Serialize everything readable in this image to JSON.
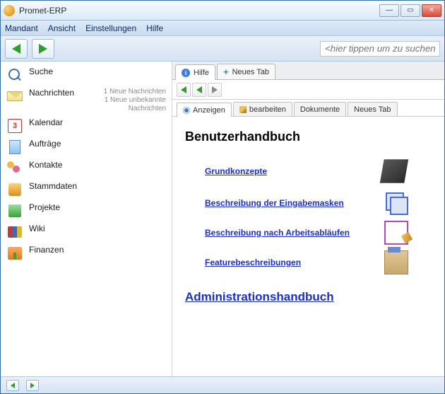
{
  "window": {
    "title": "Promet-ERP"
  },
  "menu": {
    "items": [
      "Mandant",
      "Ansicht",
      "Einstellungen",
      "Hilfe"
    ]
  },
  "toolbar": {
    "search_placeholder": "<hier tippen um zu suchen>"
  },
  "sidebar": {
    "items": [
      {
        "label": "Suche"
      },
      {
        "label": "Nachrichten",
        "sub1": "1 Neue Nachrichten",
        "sub2": "1 Neue unbekannte Nachrichten"
      },
      {
        "label": "Kalendar",
        "day": "3"
      },
      {
        "label": "Aufträge"
      },
      {
        "label": "Kontakte"
      },
      {
        "label": "Stammdaten"
      },
      {
        "label": "Projekte"
      },
      {
        "label": "Wiki"
      },
      {
        "label": "Finanzen"
      }
    ]
  },
  "outer_tabs": {
    "hilfe": "Hilfe",
    "neues": "Neues Tab"
  },
  "inner_tabs": {
    "anzeigen": "Anzeigen",
    "bearbeiten": "bearbeiten",
    "dokumente": "Dokumente",
    "neues": "Neues Tab"
  },
  "content": {
    "heading": "Benutzerhandbuch",
    "links": {
      "grundkonzepte": "Grundkonzepte",
      "eingabemasken": "Beschreibung der Eingabemasken",
      "arbeitsablaeufe": "Beschreibung nach Arbeitsabläufen",
      "features": "Featurebeschreibungen"
    },
    "admin_link": "Administrationshandbuch"
  }
}
